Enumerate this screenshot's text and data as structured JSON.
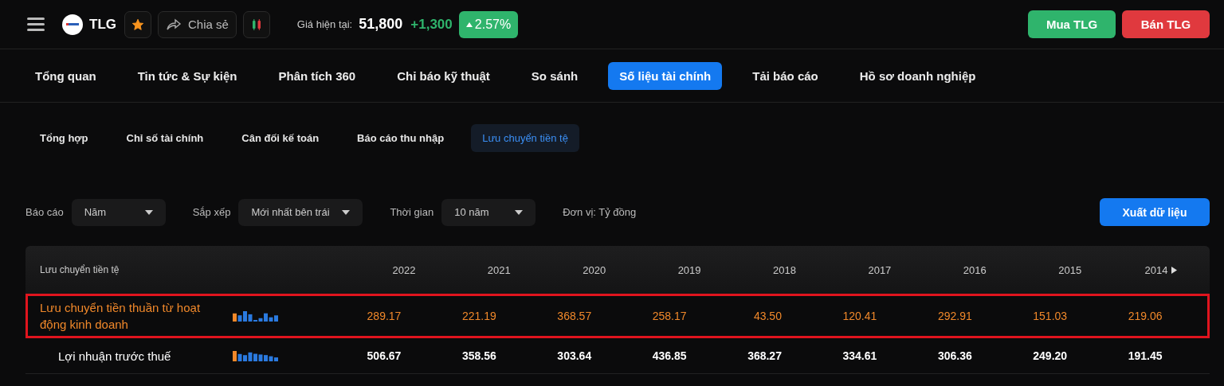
{
  "header": {
    "ticker": "TLG",
    "favorite": true,
    "share_label": "Chia sẻ",
    "price_label": "Giá hiện tại:",
    "price": "51,800",
    "change": "+1,300",
    "change_pct": "2.57%",
    "buy_label": "Mua TLG",
    "sell_label": "Bán TLG"
  },
  "tabs": [
    {
      "label": "Tổng quan",
      "selected": false
    },
    {
      "label": "Tin tức & Sự kiện",
      "selected": false
    },
    {
      "label": "Phân tích 360",
      "selected": false
    },
    {
      "label": "Chỉ báo kỹ thuật",
      "selected": false
    },
    {
      "label": "So sánh",
      "selected": false
    },
    {
      "label": "Số liệu tài chính",
      "selected": true
    },
    {
      "label": "Tải báo cáo",
      "selected": false
    },
    {
      "label": "Hồ sơ doanh nghiệp",
      "selected": false
    }
  ],
  "subtabs": [
    {
      "label": "Tổng hợp",
      "selected": false
    },
    {
      "label": "Chỉ số tài chính",
      "selected": false
    },
    {
      "label": "Cân đối kế toán",
      "selected": false
    },
    {
      "label": "Báo cáo thu nhập",
      "selected": false
    },
    {
      "label": "Lưu chuyển tiền tệ",
      "selected": true
    }
  ],
  "filters": [
    {
      "label": "Báo cáo",
      "value": "Năm"
    },
    {
      "label": "Sắp xếp",
      "value": "Mới nhất bên trái"
    },
    {
      "label": "Thời gian",
      "value": "10 năm"
    }
  ],
  "unit": "Đơn vị: Tỷ đồng",
  "export_label": "Xuất dữ liệu",
  "table": {
    "title": "Lưu chuyển tiền tệ",
    "columns": [
      "2022",
      "2021",
      "2020",
      "2019",
      "2018",
      "2017",
      "2016",
      "2015",
      "2014"
    ],
    "rows": [
      {
        "label": "Lưu chuyển tiền thuần từ hoạt động kinh doanh",
        "highlighted": true,
        "indent": false,
        "values": [
          "289.17",
          "221.19",
          "368.57",
          "258.17",
          "43.50",
          "120.41",
          "292.91",
          "151.03",
          "219.06"
        ]
      },
      {
        "label": "Lợi nhuận trước thuế",
        "highlighted": false,
        "indent": true,
        "values": [
          "506.67",
          "358.56",
          "303.64",
          "436.85",
          "368.27",
          "334.61",
          "306.36",
          "249.20",
          "191.45"
        ]
      }
    ]
  }
}
